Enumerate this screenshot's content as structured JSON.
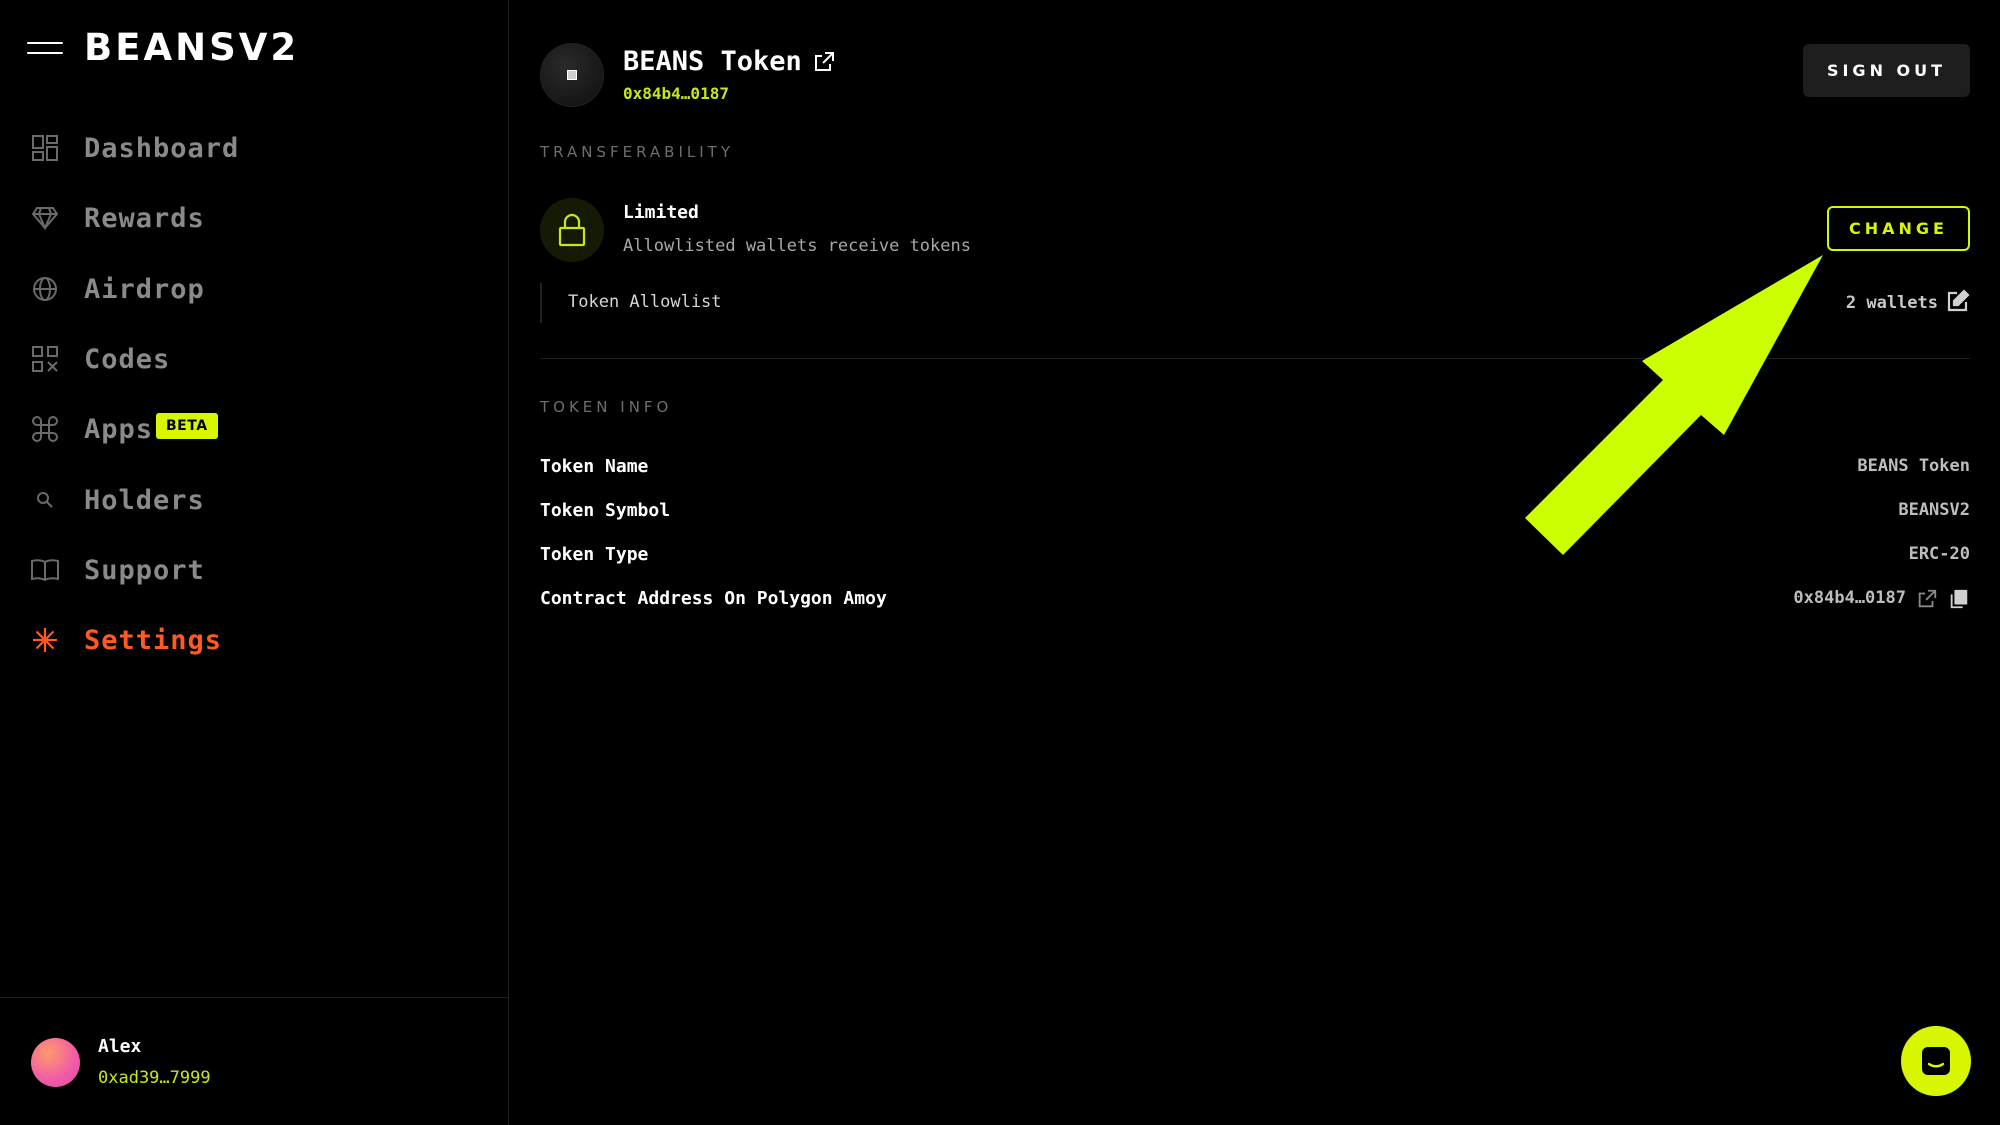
{
  "sidebar": {
    "logo": "BEANSV2",
    "items": [
      {
        "label": "Dashboard",
        "icon": "dashboard-icon"
      },
      {
        "label": "Rewards",
        "icon": "diamond-icon"
      },
      {
        "label": "Airdrop",
        "icon": "globe-icon"
      },
      {
        "label": "Codes",
        "icon": "qr-code-icon"
      },
      {
        "label": "Apps",
        "icon": "command-icon",
        "badge": "BETA"
      },
      {
        "label": "Holders",
        "icon": "search-icon"
      },
      {
        "label": "Support",
        "icon": "book-icon"
      },
      {
        "label": "Settings",
        "icon": "asterisk-icon",
        "active": true
      }
    ],
    "user": {
      "name": "Alex",
      "address": "0xad39…7999"
    }
  },
  "header": {
    "token_name": "BEANS Token",
    "token_address": "0x84b4…0187",
    "sign_out": "SIGN OUT"
  },
  "transferability": {
    "section_label": "TRANSFERABILITY",
    "mode": "Limited",
    "description": "Allowlisted wallets receive tokens",
    "change_label": "CHANGE",
    "allowlist_label": "Token Allowlist",
    "allowlist_count": "2 wallets"
  },
  "token_info": {
    "section_label": "TOKEN INFO",
    "rows": [
      {
        "key": "Token Name",
        "value": "BEANS Token"
      },
      {
        "key": "Token Symbol",
        "value": "BEANSV2"
      },
      {
        "key": "Token Type",
        "value": "ERC-20"
      },
      {
        "key": "Contract Address On Polygon Amoy",
        "value": "0x84b4…0187"
      }
    ]
  },
  "colors": {
    "accent": "#d8f600",
    "active_nav": "#ff5a1f",
    "background": "#000000"
  }
}
